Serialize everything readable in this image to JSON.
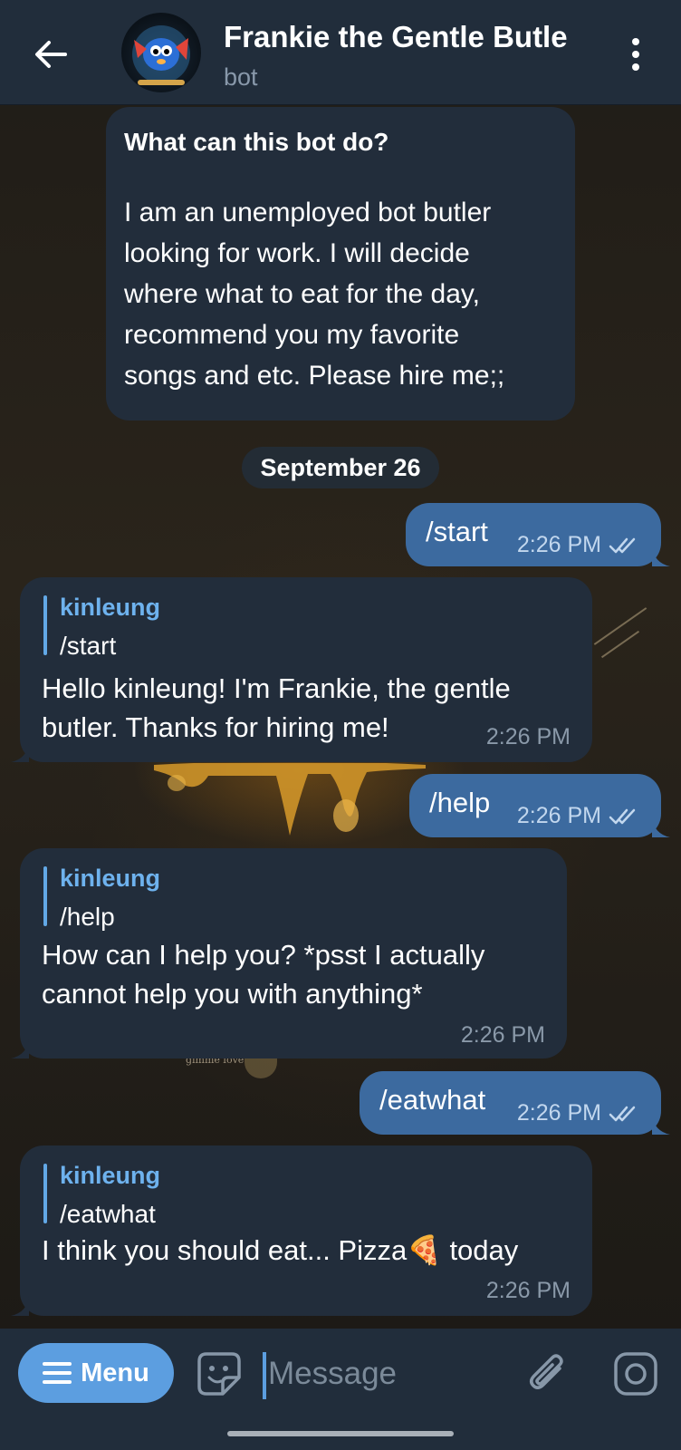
{
  "header": {
    "title": "Frankie the Gentle Butle",
    "subtitle": "bot"
  },
  "bot_info": {
    "heading": "What can this bot do?",
    "lines": [
      "I am an unemployed bot butler",
      "looking for work. I will decide",
      "where what to eat for the day,",
      "recommend you my favorite",
      "songs and etc. Please hire me;;"
    ]
  },
  "date_separator": "September 26",
  "messages": [
    {
      "dir": "out",
      "text": "/start",
      "time": "2:26 PM",
      "status": "read"
    },
    {
      "dir": "in",
      "quote_name": "kinleung",
      "quote_text": "/start",
      "lines": [
        "Hello kinleung! I'm Frankie, the gentle",
        "butler. Thanks for hiring me!"
      ],
      "time": "2:26 PM"
    },
    {
      "dir": "out",
      "text": "/help",
      "time": "2:26 PM",
      "status": "read"
    },
    {
      "dir": "in",
      "quote_name": "kinleung",
      "quote_text": "/help",
      "lines": [
        "How can I help you? *psst I actually",
        "cannot help you with anything*"
      ],
      "time": "2:26 PM"
    },
    {
      "dir": "out",
      "text": "/eatwhat",
      "time": "2:26 PM",
      "status": "read"
    },
    {
      "dir": "in",
      "quote_name": "kinleung",
      "quote_text": "/eatwhat",
      "lines": [
        "I think you should eat... Pizza🍕 today"
      ],
      "time": "2:26 PM"
    }
  ],
  "composer": {
    "menu_label": "Menu",
    "placeholder": "Message"
  },
  "colors": {
    "header_bg": "#212d3b",
    "incoming_bubble": "#222d3b",
    "outgoing_bubble": "#3c6a9f",
    "accent": "#5c9ee0",
    "quote_name": "#6eb2ee"
  }
}
